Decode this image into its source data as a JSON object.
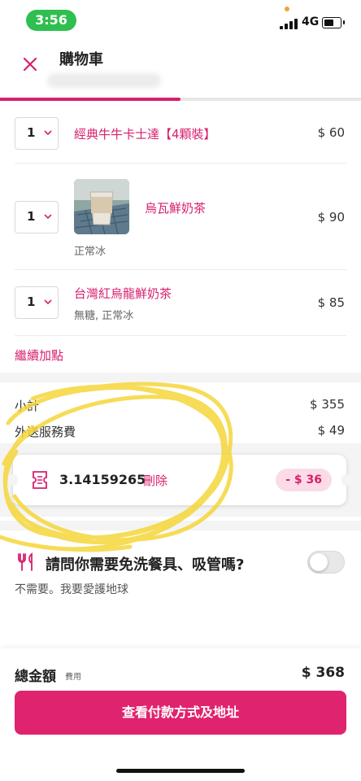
{
  "status_bar": {
    "time": "3:56",
    "network": "4G",
    "battery_level": 0.6
  },
  "header": {
    "title": "購物車",
    "close_icon": "close-icon",
    "step_progress": 0.5
  },
  "items": [
    {
      "qty": "1",
      "name": "經典牛牛卡士達【4顆裝】",
      "options": "",
      "price": "$ 60"
    },
    {
      "qty": "1",
      "name": "烏瓦鮮奶茶",
      "options": "正常冰",
      "price": "$ 90"
    },
    {
      "qty": "1",
      "name": "台灣紅烏龍鮮奶茶",
      "options": "無糖, 正常冰",
      "price": "$ 85"
    }
  ],
  "add_more_label": "繼續加點",
  "summary": {
    "subtotal_label": "小計",
    "subtotal_value": "$ 355",
    "delivery_label": "外送服務費",
    "delivery_value": "$ 49"
  },
  "voucher": {
    "code": "3.14159265",
    "delete_label": "刪除",
    "discount": "- $ 36",
    "icon": "voucher-icon"
  },
  "cutlery": {
    "question": "請問你需要免洗餐具、吸管嗎?",
    "note": "不需要。我要愛護地球",
    "enabled": false,
    "icon": "cutlery-icon"
  },
  "total": {
    "label": "總金額",
    "note": "費用",
    "value": "$ 368"
  },
  "checkout_button": "查看付款方式及地址",
  "colors": {
    "brand": "#d71f6e",
    "button": "#e0236f",
    "badge_bg": "#fbdbe7",
    "status_pill": "#2fbf4f",
    "highlight_scribble": "#f5d63a"
  }
}
